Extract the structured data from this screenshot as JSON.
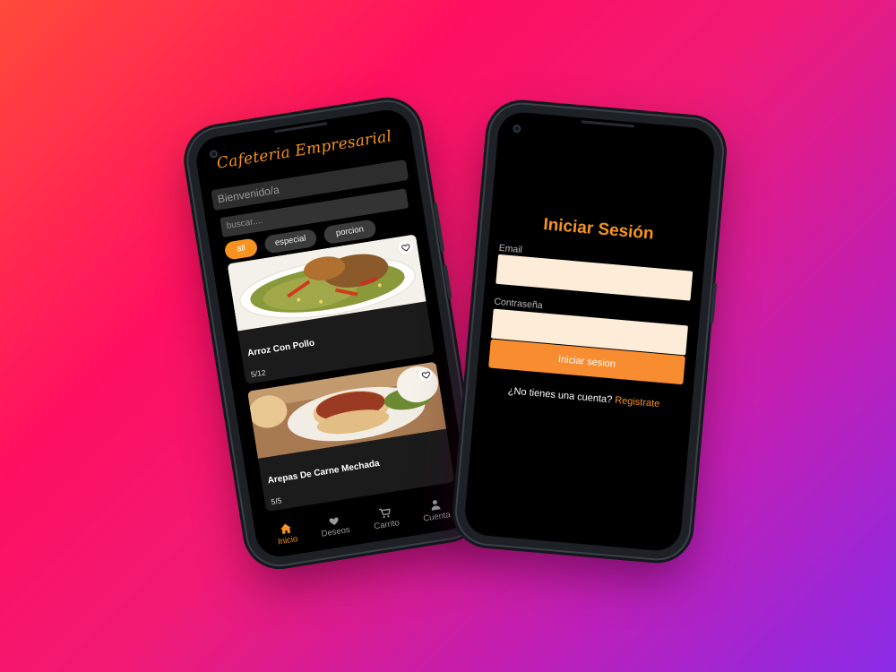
{
  "left_app": {
    "brand": "Cafeteria Empresarial",
    "welcome": "Bienvenido/a",
    "search_placeholder": "buscar....",
    "filters": [
      "all",
      "especial",
      "porcion"
    ],
    "active_filter": "all",
    "products": [
      {
        "name": "Arroz Con Pollo",
        "count": "5/12",
        "image": "rice-with-chicken-photo"
      },
      {
        "name": "Arepas De Carne Mechada",
        "count": "5/5",
        "image": "arepas-photo"
      },
      {
        "name": "",
        "count": "",
        "image": "soup-photo"
      }
    ],
    "nav": [
      {
        "label": "Inicio",
        "icon": "home-icon",
        "active": true
      },
      {
        "label": "Deseos",
        "icon": "heart-icon",
        "active": false
      },
      {
        "label": "Carrito",
        "icon": "cart-icon",
        "active": false
      },
      {
        "label": "Cuenta",
        "icon": "user-icon",
        "active": false
      }
    ]
  },
  "right_app": {
    "title": "Iniciar Sesión",
    "email_label": "Email",
    "password_label": "Contraseña",
    "login_button": "Iniciar sesion",
    "register_prompt": "¿No tienes una cuenta?",
    "register_link": "Registrate"
  },
  "colors": {
    "accent": "#f7931e",
    "input_bg": "#fdecd8",
    "button": "#f78c30"
  }
}
